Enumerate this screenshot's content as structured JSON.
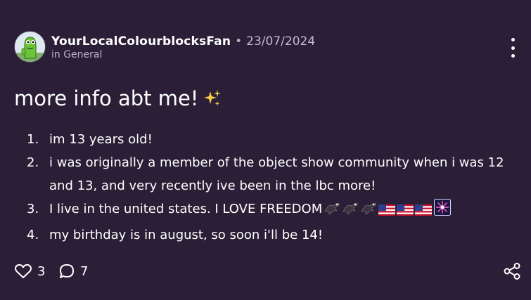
{
  "post": {
    "author": "YourLocalColourblocksFan",
    "date": "23/07/2024",
    "category": "in General",
    "title": "more info abt me!",
    "items": [
      {
        "num": "1.",
        "text": "im 13 years old!"
      },
      {
        "num": "2.",
        "text": "i was originally a member of the object show community when i was 12 and 13, and very recently ive been in the lbc more!"
      },
      {
        "num": "3.",
        "text": "I live in the united states. I LOVE FREEDOM"
      },
      {
        "num": "4.",
        "text": "my birthday is in august, so soon i'll be 14!"
      }
    ],
    "likes": "3",
    "comments": "7"
  },
  "icons": {
    "sparkles": "sparkles-icon",
    "eagle": "eagle-emoji",
    "flag": "us-flag-emoji",
    "firework": "firework-emoji",
    "more": "more-vertical-icon",
    "heart": "heart-icon",
    "comment": "comment-icon",
    "share": "share-icon"
  },
  "colors": {
    "background": "#2a1f36",
    "text": "#ffffff",
    "muted": "#bdb3c9"
  }
}
